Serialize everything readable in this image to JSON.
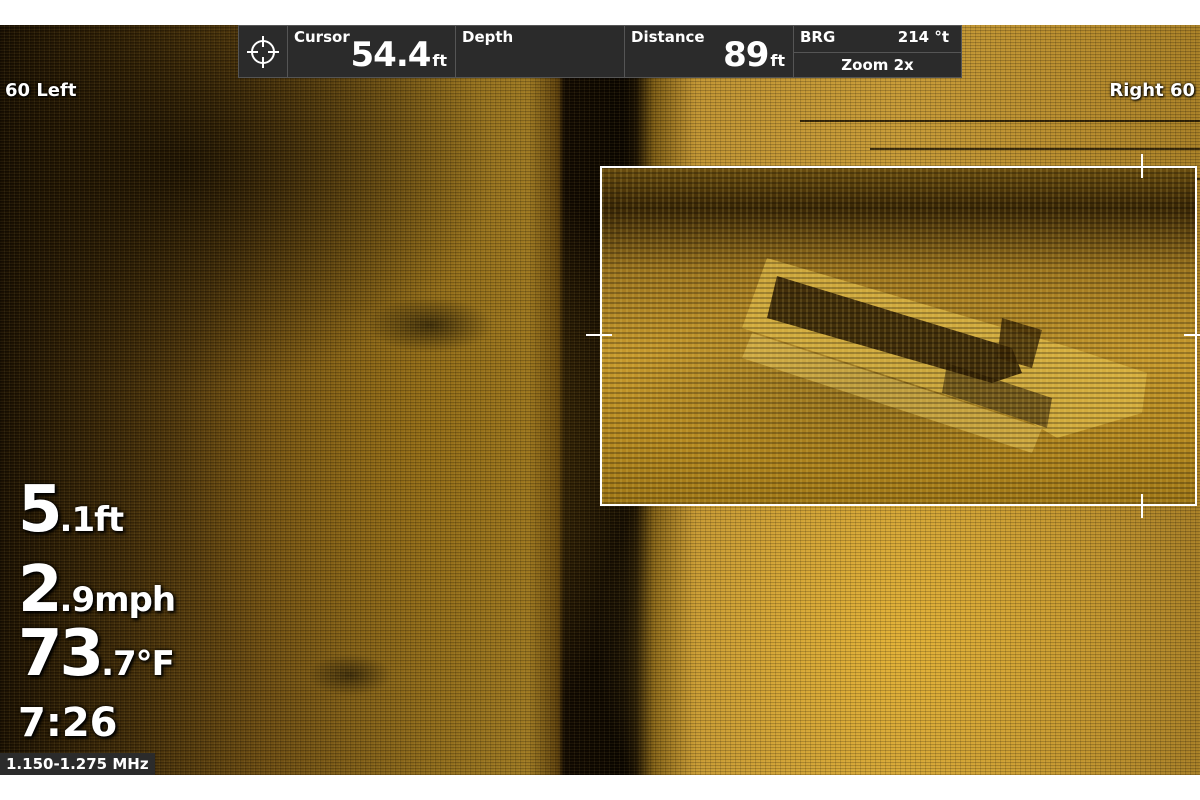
{
  "header": {
    "cursor": {
      "label": "Cursor",
      "value": "54.4",
      "unit": "ft"
    },
    "depth": {
      "label": "Depth",
      "value": "",
      "unit": ""
    },
    "distance": {
      "label": "Distance",
      "value": "89",
      "unit": "ft"
    },
    "brg": {
      "label": "BRG",
      "value": "214 °t"
    },
    "zoom": "Zoom 2x"
  },
  "range": {
    "left": "60 Left",
    "right": "Right 60"
  },
  "readouts": {
    "depth": {
      "int": "5",
      "rest": ".1ft"
    },
    "speed": {
      "int": "2",
      "rest": ".9mph"
    },
    "temp": {
      "int": "73",
      "rest": ".7°F"
    },
    "time": "7:26"
  },
  "frequency": "1.150-1.275 MHz",
  "icons": {
    "cursor": "crosshair-target-icon"
  },
  "colors": {
    "sonar_gold": "#c69a37",
    "header_bg": "#2b2b2b",
    "text": "#ffffff"
  }
}
